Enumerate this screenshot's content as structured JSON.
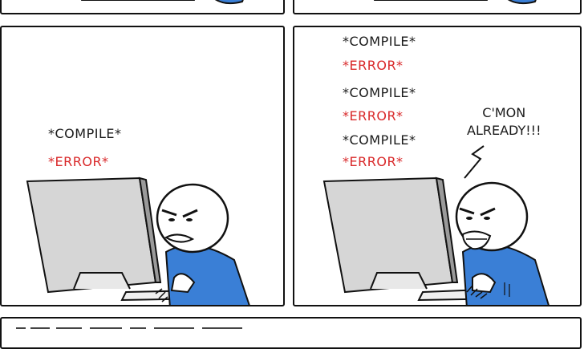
{
  "left_panel": {
    "lines": [
      {
        "text": "*COMPILE*",
        "kind": "compile"
      },
      {
        "text": "*ERROR*",
        "kind": "error"
      }
    ]
  },
  "right_panel": {
    "lines": [
      {
        "text": "*COMPILE*",
        "kind": "compile"
      },
      {
        "text": "*ERROR*",
        "kind": "error"
      },
      {
        "text": "*COMPILE*",
        "kind": "compile"
      },
      {
        "text": "*ERROR*",
        "kind": "error"
      },
      {
        "text": "*COMPILE*",
        "kind": "compile"
      },
      {
        "text": "*ERROR*",
        "kind": "error"
      }
    ],
    "speech_line1": "C'MON",
    "speech_line2": "ALREADY!!!"
  },
  "colors": {
    "ink": "#111111",
    "error_red": "#d9292a",
    "shirt_blue": "#3a7fd6",
    "monitor_gray": "#d6d6d6"
  }
}
